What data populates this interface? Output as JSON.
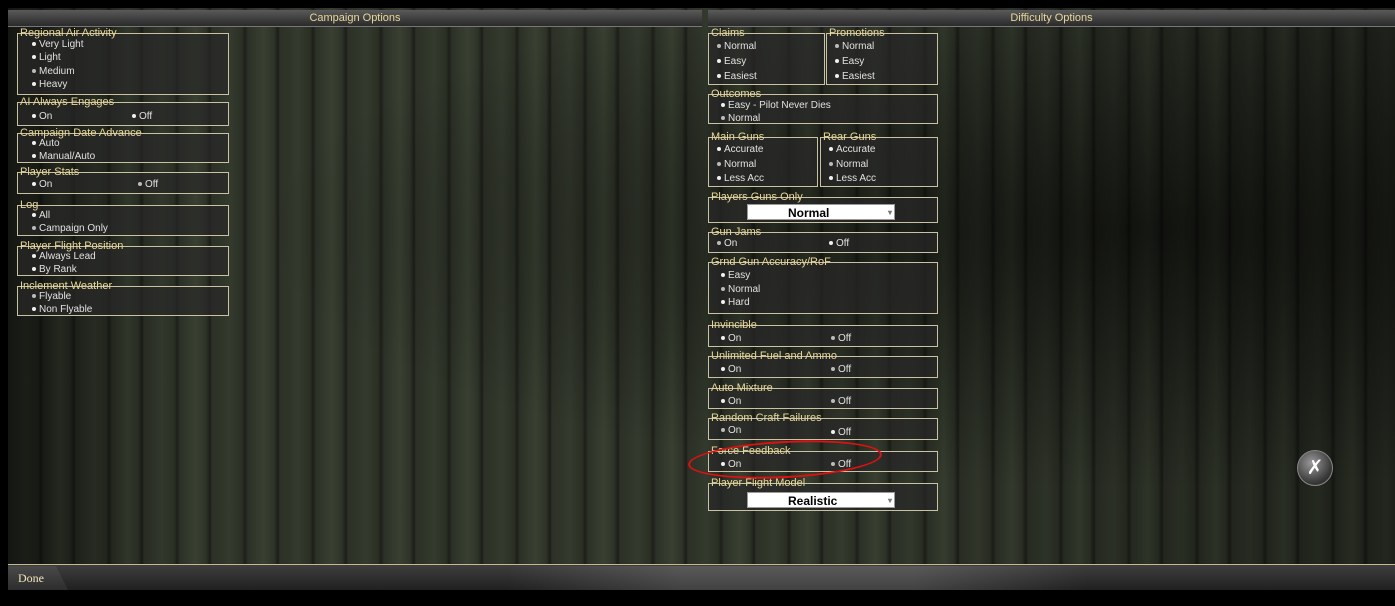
{
  "campaign_header": "Campaign Options",
  "difficulty_header": "Difficulty Options",
  "campaign": {
    "regional": {
      "title": "Regional Air Activity",
      "options": [
        "Very Light",
        "Light",
        "Medium",
        "Heavy"
      ]
    },
    "ai_engages": {
      "title": "AI Always Engages",
      "options": [
        "On",
        "Off"
      ]
    },
    "date_advance": {
      "title": "Campaign Date Advance",
      "options": [
        "Auto",
        "Manual/Auto"
      ]
    },
    "player_stats": {
      "title": "Player Stats",
      "options": [
        "On",
        "Off"
      ]
    },
    "log": {
      "title": "Log",
      "options": [
        "All",
        "Campaign Only"
      ]
    },
    "flight_position": {
      "title": "Player Flight Position",
      "options": [
        "Always Lead",
        "By Rank"
      ]
    },
    "weather": {
      "title": "Inclement Weather",
      "options": [
        "Flyable",
        "Non Flyable"
      ]
    }
  },
  "difficulty": {
    "claims": {
      "title": "Claims",
      "options": [
        "Normal",
        "Easy",
        "Easiest"
      ]
    },
    "promotions": {
      "title": "Promotions",
      "options": [
        "Normal",
        "Easy",
        "Easiest"
      ]
    },
    "outcomes": {
      "title": "Outcomes",
      "options": [
        "Easy - Pilot Never Dies",
        "Normal"
      ]
    },
    "main_guns": {
      "title": "Main Guns",
      "options": [
        "Accurate",
        "Normal",
        "Less Acc"
      ]
    },
    "rear_guns": {
      "title": "Rear Guns",
      "options": [
        "Accurate",
        "Normal",
        "Less Acc"
      ]
    },
    "players_guns_only": {
      "title": "Players Guns Only",
      "value": "Normal"
    },
    "gun_jams": {
      "title": "Gun Jams",
      "options": [
        "On",
        "Off"
      ]
    },
    "grnd_gun": {
      "title": "Grnd Gun Accuracy/RoF",
      "options": [
        "Easy",
        "Normal",
        "Hard"
      ]
    },
    "invincible": {
      "title": "Invincible",
      "options": [
        "On",
        "Off"
      ]
    },
    "unlimited": {
      "title": "Unlimited Fuel and Ammo",
      "options": [
        "On",
        "Off"
      ]
    },
    "auto_mixture": {
      "title": "Auto Mixture",
      "options": [
        "On",
        "Off"
      ]
    },
    "random_failures": {
      "title": "Random Craft Failures",
      "options": [
        "On",
        "Off"
      ]
    },
    "force_feedback": {
      "title": "Force Feedback",
      "options": [
        "On",
        "Off"
      ]
    },
    "flight_model": {
      "title": "Player Flight Model",
      "value": "Realistic"
    }
  },
  "footer": {
    "done_label": "Done"
  },
  "close_icon_glyph": "✗"
}
